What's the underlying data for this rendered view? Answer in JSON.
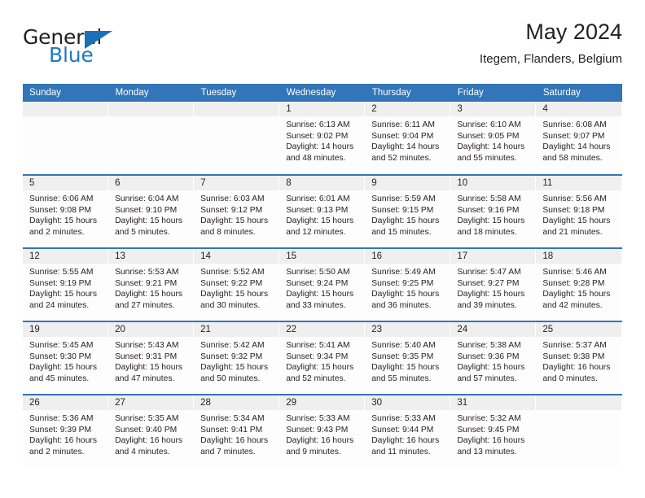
{
  "logo": {
    "word_one": "General",
    "word_two": "Blue",
    "triangle_icon": "blue-triangle-icon",
    "accent_color": "#1c6fb8"
  },
  "header": {
    "title": "May 2024",
    "subtitle": "Itegem, Flanders, Belgium"
  },
  "calendar": {
    "header_color": "#3275b8",
    "daynum_band_color": "#efefef",
    "weekday_headers": [
      "Sunday",
      "Monday",
      "Tuesday",
      "Wednesday",
      "Thursday",
      "Friday",
      "Saturday"
    ],
    "weeks": [
      [
        {
          "day": "",
          "empty": true
        },
        {
          "day": "",
          "empty": true
        },
        {
          "day": "",
          "empty": true
        },
        {
          "day": "1",
          "sunrise": "Sunrise: 6:13 AM",
          "sunset": "Sunset: 9:02 PM",
          "daylight_line1": "Daylight: 14 hours",
          "daylight_line2": "and 48 minutes."
        },
        {
          "day": "2",
          "sunrise": "Sunrise: 6:11 AM",
          "sunset": "Sunset: 9:04 PM",
          "daylight_line1": "Daylight: 14 hours",
          "daylight_line2": "and 52 minutes."
        },
        {
          "day": "3",
          "sunrise": "Sunrise: 6:10 AM",
          "sunset": "Sunset: 9:05 PM",
          "daylight_line1": "Daylight: 14 hours",
          "daylight_line2": "and 55 minutes."
        },
        {
          "day": "4",
          "sunrise": "Sunrise: 6:08 AM",
          "sunset": "Sunset: 9:07 PM",
          "daylight_line1": "Daylight: 14 hours",
          "daylight_line2": "and 58 minutes."
        }
      ],
      [
        {
          "day": "5",
          "sunrise": "Sunrise: 6:06 AM",
          "sunset": "Sunset: 9:08 PM",
          "daylight_line1": "Daylight: 15 hours",
          "daylight_line2": "and 2 minutes."
        },
        {
          "day": "6",
          "sunrise": "Sunrise: 6:04 AM",
          "sunset": "Sunset: 9:10 PM",
          "daylight_line1": "Daylight: 15 hours",
          "daylight_line2": "and 5 minutes."
        },
        {
          "day": "7",
          "sunrise": "Sunrise: 6:03 AM",
          "sunset": "Sunset: 9:12 PM",
          "daylight_line1": "Daylight: 15 hours",
          "daylight_line2": "and 8 minutes."
        },
        {
          "day": "8",
          "sunrise": "Sunrise: 6:01 AM",
          "sunset": "Sunset: 9:13 PM",
          "daylight_line1": "Daylight: 15 hours",
          "daylight_line2": "and 12 minutes."
        },
        {
          "day": "9",
          "sunrise": "Sunrise: 5:59 AM",
          "sunset": "Sunset: 9:15 PM",
          "daylight_line1": "Daylight: 15 hours",
          "daylight_line2": "and 15 minutes."
        },
        {
          "day": "10",
          "sunrise": "Sunrise: 5:58 AM",
          "sunset": "Sunset: 9:16 PM",
          "daylight_line1": "Daylight: 15 hours",
          "daylight_line2": "and 18 minutes."
        },
        {
          "day": "11",
          "sunrise": "Sunrise: 5:56 AM",
          "sunset": "Sunset: 9:18 PM",
          "daylight_line1": "Daylight: 15 hours",
          "daylight_line2": "and 21 minutes."
        }
      ],
      [
        {
          "day": "12",
          "sunrise": "Sunrise: 5:55 AM",
          "sunset": "Sunset: 9:19 PM",
          "daylight_line1": "Daylight: 15 hours",
          "daylight_line2": "and 24 minutes."
        },
        {
          "day": "13",
          "sunrise": "Sunrise: 5:53 AM",
          "sunset": "Sunset: 9:21 PM",
          "daylight_line1": "Daylight: 15 hours",
          "daylight_line2": "and 27 minutes."
        },
        {
          "day": "14",
          "sunrise": "Sunrise: 5:52 AM",
          "sunset": "Sunset: 9:22 PM",
          "daylight_line1": "Daylight: 15 hours",
          "daylight_line2": "and 30 minutes."
        },
        {
          "day": "15",
          "sunrise": "Sunrise: 5:50 AM",
          "sunset": "Sunset: 9:24 PM",
          "daylight_line1": "Daylight: 15 hours",
          "daylight_line2": "and 33 minutes."
        },
        {
          "day": "16",
          "sunrise": "Sunrise: 5:49 AM",
          "sunset": "Sunset: 9:25 PM",
          "daylight_line1": "Daylight: 15 hours",
          "daylight_line2": "and 36 minutes."
        },
        {
          "day": "17",
          "sunrise": "Sunrise: 5:47 AM",
          "sunset": "Sunset: 9:27 PM",
          "daylight_line1": "Daylight: 15 hours",
          "daylight_line2": "and 39 minutes."
        },
        {
          "day": "18",
          "sunrise": "Sunrise: 5:46 AM",
          "sunset": "Sunset: 9:28 PM",
          "daylight_line1": "Daylight: 15 hours",
          "daylight_line2": "and 42 minutes."
        }
      ],
      [
        {
          "day": "19",
          "sunrise": "Sunrise: 5:45 AM",
          "sunset": "Sunset: 9:30 PM",
          "daylight_line1": "Daylight: 15 hours",
          "daylight_line2": "and 45 minutes."
        },
        {
          "day": "20",
          "sunrise": "Sunrise: 5:43 AM",
          "sunset": "Sunset: 9:31 PM",
          "daylight_line1": "Daylight: 15 hours",
          "daylight_line2": "and 47 minutes."
        },
        {
          "day": "21",
          "sunrise": "Sunrise: 5:42 AM",
          "sunset": "Sunset: 9:32 PM",
          "daylight_line1": "Daylight: 15 hours",
          "daylight_line2": "and 50 minutes."
        },
        {
          "day": "22",
          "sunrise": "Sunrise: 5:41 AM",
          "sunset": "Sunset: 9:34 PM",
          "daylight_line1": "Daylight: 15 hours",
          "daylight_line2": "and 52 minutes."
        },
        {
          "day": "23",
          "sunrise": "Sunrise: 5:40 AM",
          "sunset": "Sunset: 9:35 PM",
          "daylight_line1": "Daylight: 15 hours",
          "daylight_line2": "and 55 minutes."
        },
        {
          "day": "24",
          "sunrise": "Sunrise: 5:38 AM",
          "sunset": "Sunset: 9:36 PM",
          "daylight_line1": "Daylight: 15 hours",
          "daylight_line2": "and 57 minutes."
        },
        {
          "day": "25",
          "sunrise": "Sunrise: 5:37 AM",
          "sunset": "Sunset: 9:38 PM",
          "daylight_line1": "Daylight: 16 hours",
          "daylight_line2": "and 0 minutes."
        }
      ],
      [
        {
          "day": "26",
          "sunrise": "Sunrise: 5:36 AM",
          "sunset": "Sunset: 9:39 PM",
          "daylight_line1": "Daylight: 16 hours",
          "daylight_line2": "and 2 minutes."
        },
        {
          "day": "27",
          "sunrise": "Sunrise: 5:35 AM",
          "sunset": "Sunset: 9:40 PM",
          "daylight_line1": "Daylight: 16 hours",
          "daylight_line2": "and 4 minutes."
        },
        {
          "day": "28",
          "sunrise": "Sunrise: 5:34 AM",
          "sunset": "Sunset: 9:41 PM",
          "daylight_line1": "Daylight: 16 hours",
          "daylight_line2": "and 7 minutes."
        },
        {
          "day": "29",
          "sunrise": "Sunrise: 5:33 AM",
          "sunset": "Sunset: 9:43 PM",
          "daylight_line1": "Daylight: 16 hours",
          "daylight_line2": "and 9 minutes."
        },
        {
          "day": "30",
          "sunrise": "Sunrise: 5:33 AM",
          "sunset": "Sunset: 9:44 PM",
          "daylight_line1": "Daylight: 16 hours",
          "daylight_line2": "and 11 minutes."
        },
        {
          "day": "31",
          "sunrise": "Sunrise: 5:32 AM",
          "sunset": "Sunset: 9:45 PM",
          "daylight_line1": "Daylight: 16 hours",
          "daylight_line2": "and 13 minutes."
        },
        {
          "day": "",
          "empty": true
        }
      ]
    ]
  }
}
